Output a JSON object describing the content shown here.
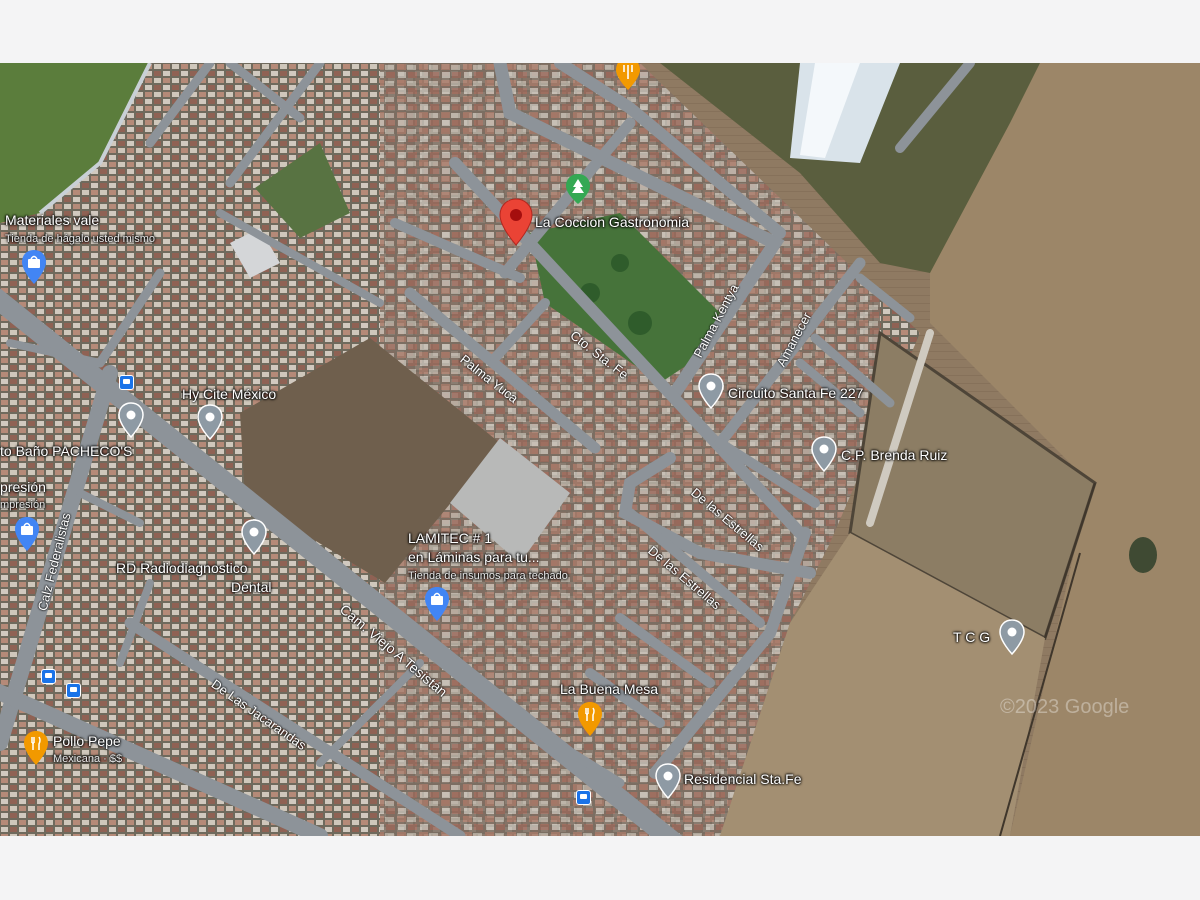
{
  "map": {
    "watermark": "©2023 Google",
    "selected_place": {
      "name": "La Coccion Gastronomia"
    },
    "places": [
      {
        "id": "materiales",
        "name": "Materiales vale",
        "sub": "Tienda de hágalo usted mismo",
        "icon": "shopping-bag-pin-icon"
      },
      {
        "id": "hycite",
        "name": "Hy Cite México",
        "sub": "",
        "icon": "pin-icon"
      },
      {
        "id": "bano",
        "name": "to Baño PACHECO'S",
        "sub": "",
        "icon": "pin-icon"
      },
      {
        "id": "impresion",
        "name": "presión",
        "sub": "mpresión",
        "icon": "shopping-bag-pin-icon"
      },
      {
        "id": "rd",
        "name": "RD Radiodiagnostico",
        "name2": "Dental",
        "icon": "pin-icon"
      },
      {
        "id": "lamitec",
        "name": "LAMITEC # 1",
        "name2": "en Láminas para tu...",
        "sub": "Tienda de insumos para techado",
        "icon": "shopping-bag-pin-icon"
      },
      {
        "id": "circuito",
        "name": "Circuito Santa Fe 227",
        "icon": "pin-icon"
      },
      {
        "id": "brenda",
        "name": "C.P. Brenda Ruiz",
        "icon": "pin-icon"
      },
      {
        "id": "tcg",
        "name": "T C G",
        "icon": "pin-icon"
      },
      {
        "id": "buena",
        "name": "La Buena Mesa",
        "icon": "restaurant-pin-icon"
      },
      {
        "id": "pollo",
        "name": "Pollo Pepe",
        "sub": "Mexicana · $$",
        "icon": "restaurant-pin-icon"
      },
      {
        "id": "residencial",
        "name": "Residencial Sta.Fe",
        "icon": "pin-icon"
      }
    ],
    "streets": [
      {
        "id": "palma-kentya",
        "name": "Palma Kentya"
      },
      {
        "id": "amanecer",
        "name": "Amanecer"
      },
      {
        "id": "cto-sta-fe",
        "name": "Cto. Sta. Fe"
      },
      {
        "id": "palma-yuca",
        "name": "Palma Yuca"
      },
      {
        "id": "estrellas-1",
        "name": "De las Estrellas"
      },
      {
        "id": "estrellas-2",
        "name": "De las Estrellas"
      },
      {
        "id": "federalistas",
        "name": "Calz Federalistas"
      },
      {
        "id": "tesistan",
        "name": "Cam. Viejo A Tesistán"
      },
      {
        "id": "jacarandas",
        "name": "De Las Jacarandas"
      }
    ],
    "colors": {
      "pin_gray": "#8e9aa4",
      "pin_red": "#ea4335",
      "pin_blue": "#4285f4",
      "pin_orange": "#f29900",
      "park_green": "#34a853",
      "transit_blue": "#1a73e8"
    }
  }
}
